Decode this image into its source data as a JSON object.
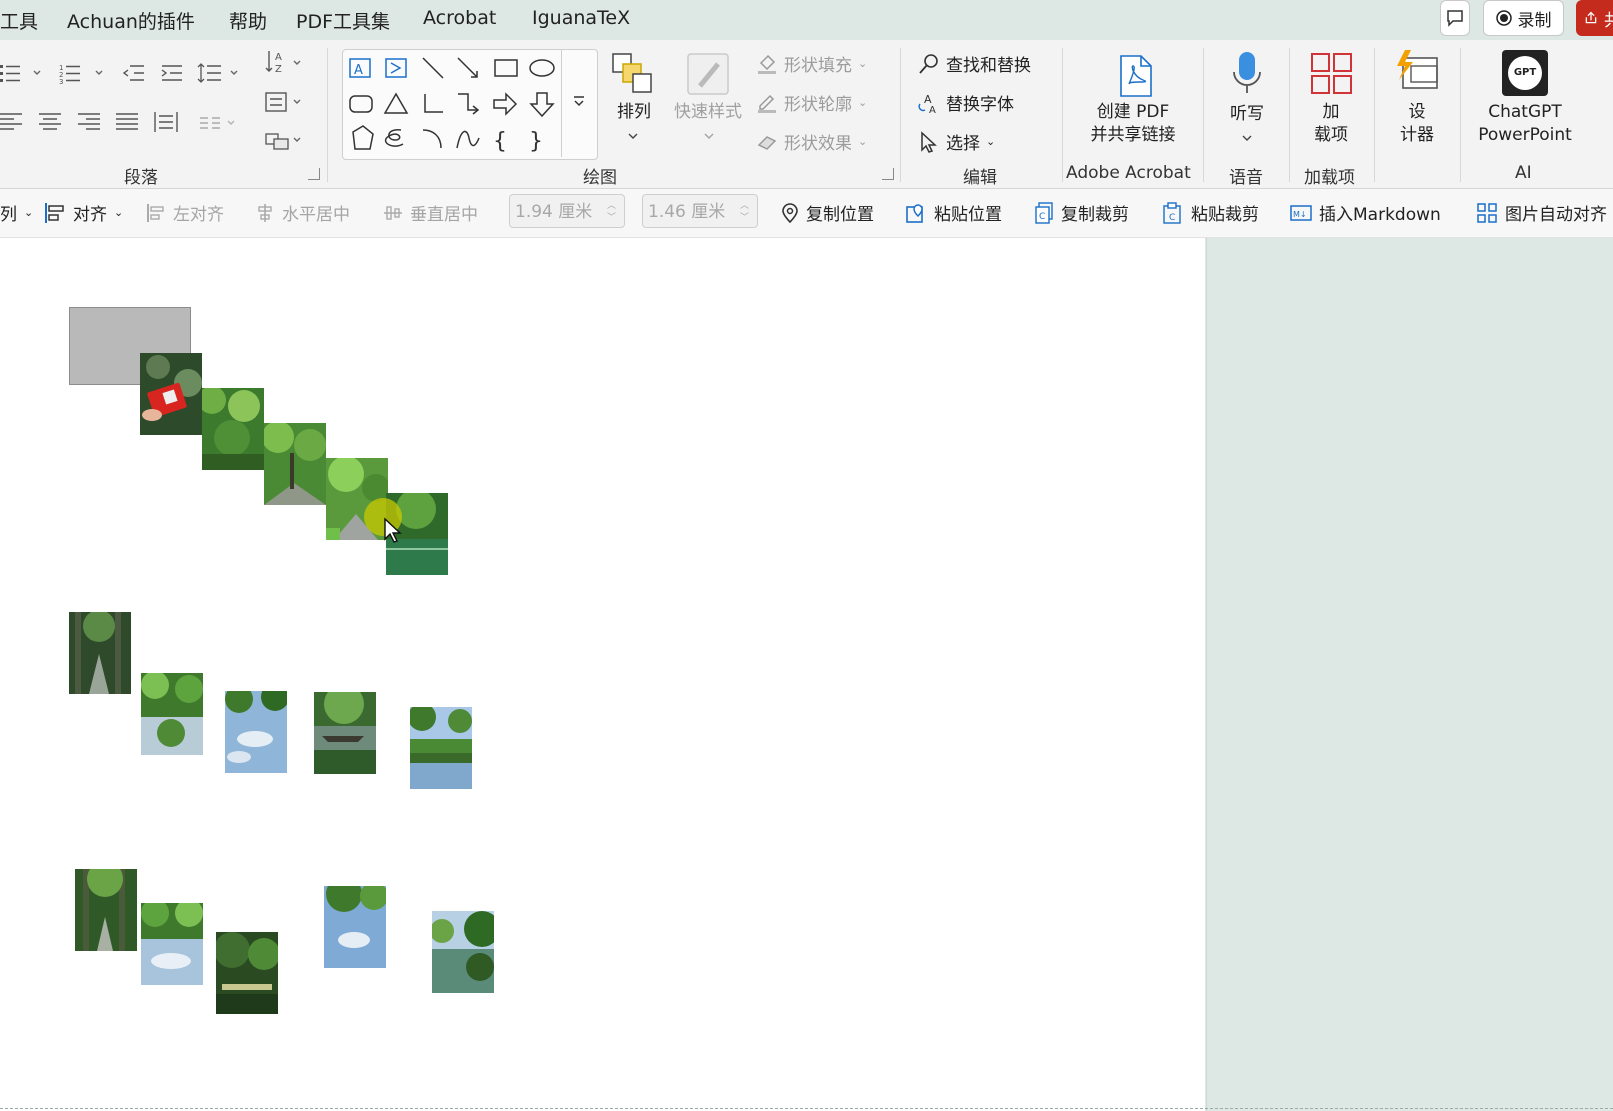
{
  "menubar": {
    "items": [
      "工具",
      "Achuan的插件",
      "帮助",
      "PDF工具集",
      "Acrobat",
      "IguanaTeX"
    ],
    "record_label": "录制",
    "share_label": "共"
  },
  "ribbon": {
    "groups": {
      "paragraph": "段落",
      "drawing": "绘图",
      "editing": "编辑",
      "adobe_acrobat": "Adobe Acrobat",
      "voice": "语音",
      "addins": "加载项",
      "ai": "AI"
    },
    "arrange_label": "排列",
    "quick_styles_label": "快速样式",
    "shape_fill": "形状填充",
    "shape_outline": "形状轮廓",
    "shape_effects": "形状效果",
    "find_replace": "查找和替换",
    "replace_font": "替换字体",
    "select": "选择",
    "create_pdf_line1": "创建 PDF",
    "create_pdf_line2": "并共享链接",
    "dictate": "听写",
    "addins_line1": "加",
    "addins_line2": "载项",
    "designer_line1": "设",
    "designer_line2": "计器",
    "chatgpt_line1": "ChatGPT",
    "chatgpt_line2": "PowerPoint",
    "chatgpt_logo_text": "GPT"
  },
  "toolbar2": {
    "arrange_cut": "列",
    "align": "对齐",
    "align_left": "左对齐",
    "h_center": "水平居中",
    "v_center": "垂直居中",
    "width_value": "1.94 厘米",
    "height_value": "1.46 厘米",
    "copy_position": "复制位置",
    "paste_position": "粘贴位置",
    "copy_crop": "复制裁剪",
    "paste_crop": "粘贴裁剪",
    "insert_markdown": "插入Markdown",
    "auto_align": "图片自动对齐"
  },
  "colors": {
    "background": "#dde7e4",
    "ribbon": "#f3f3f3",
    "accent_blue": "#1a6fc9",
    "record_red": "#c42b1c",
    "cursor_highlight": "#c8c800"
  }
}
